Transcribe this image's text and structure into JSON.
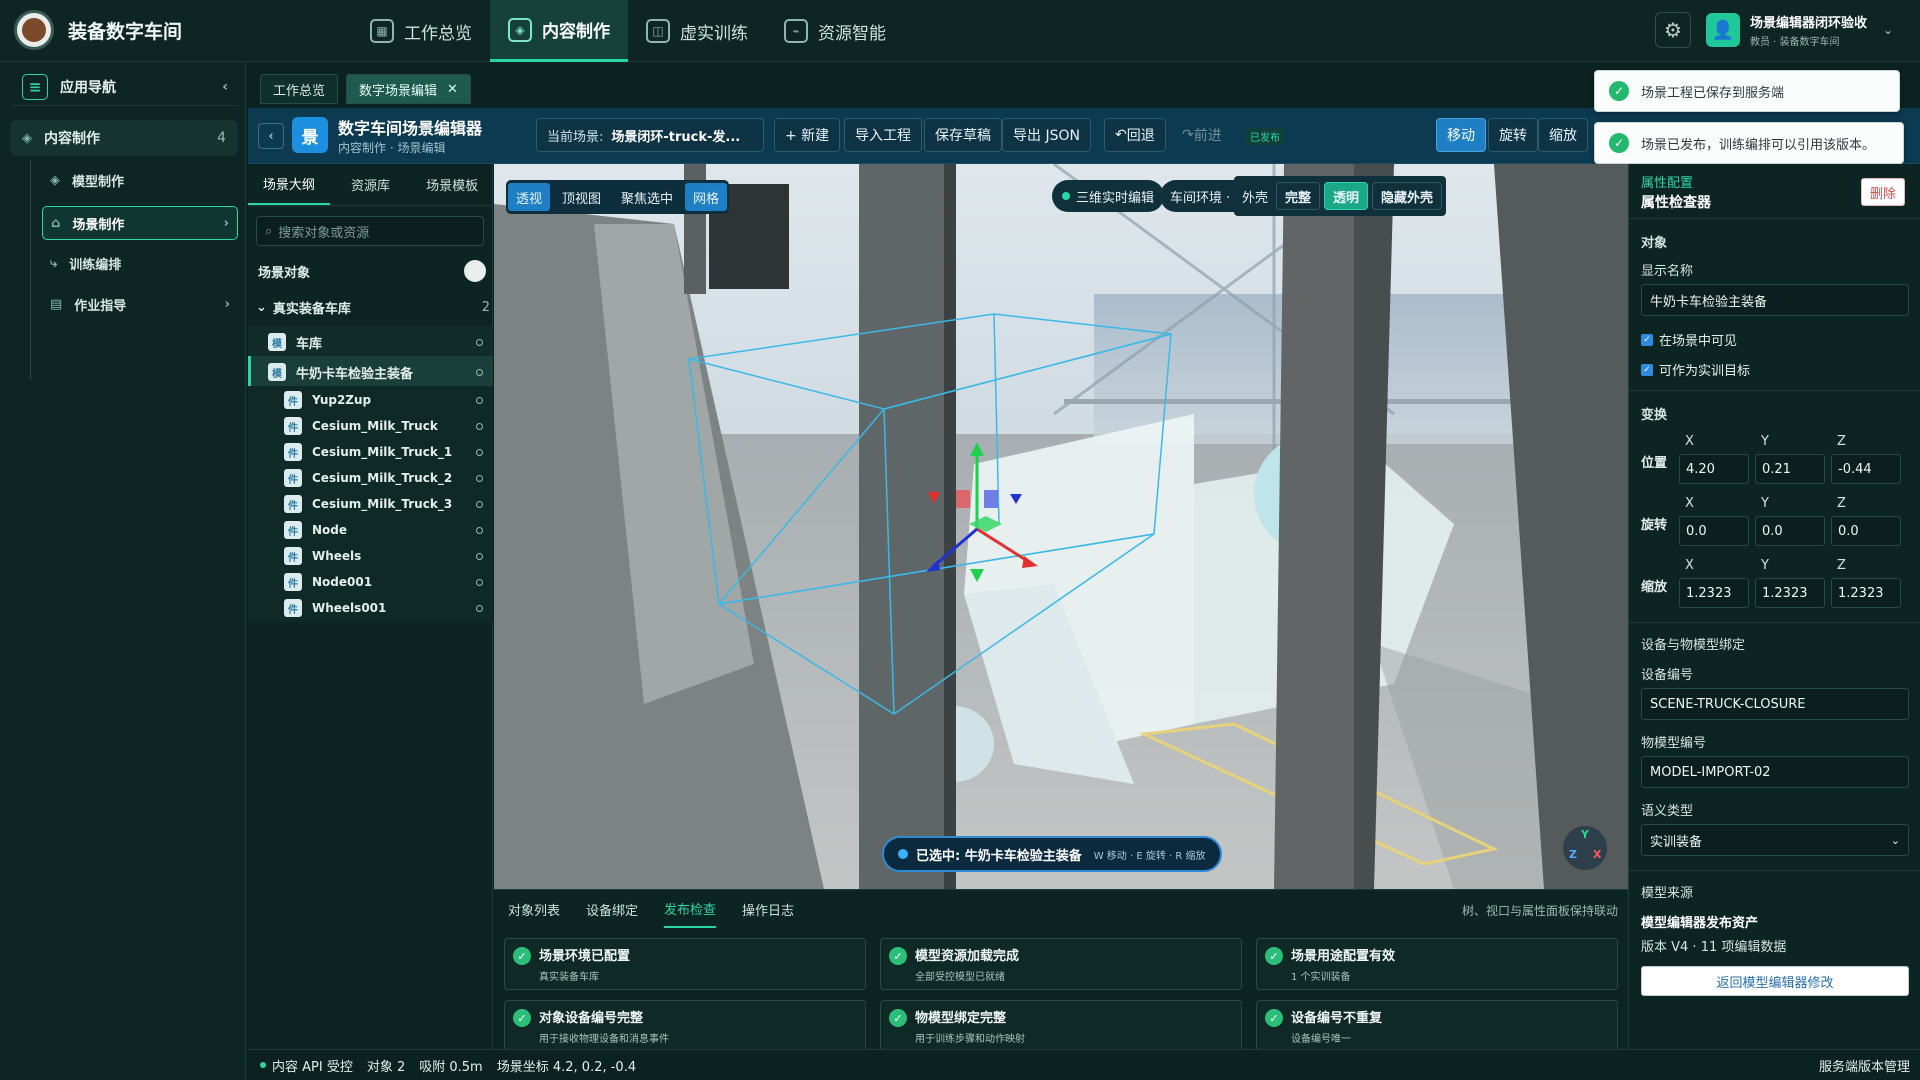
{
  "header": {
    "brand": "装备数字车间",
    "nav": [
      {
        "label": "工作总览",
        "icon": "grid-icon"
      },
      {
        "label": "内容制作",
        "icon": "cube-icon"
      },
      {
        "label": "虚实训练",
        "icon": "panel-icon"
      },
      {
        "label": "资源智能",
        "icon": "brain-icon"
      }
    ],
    "active_nav": "内容制作",
    "user_name": "场景编辑器闭环验收",
    "user_role": "教员 · 装备数字车间"
  },
  "sidebar": {
    "title": "应用导航",
    "group": {
      "label": "内容制作",
      "count": "4"
    },
    "items": [
      {
        "label": "模型制作"
      },
      {
        "label": "场景制作"
      },
      {
        "label": "训练编排"
      },
      {
        "label": "作业指导"
      }
    ]
  },
  "doc_tabs": [
    {
      "label": "工作总览"
    },
    {
      "label": "数字场景编辑"
    }
  ],
  "toolbar": {
    "app_icon": "景",
    "title": "数字车间场景编辑器",
    "subtitle": "内容制作 · 场景编辑",
    "scene_label": "当前场景:",
    "scene_value": "场景闭环-truck-发...",
    "new": "+ 新建",
    "import": "导入工程",
    "save_draft": "保存草稿",
    "export_json": "导出 JSON",
    "undo": "回退",
    "redo": "前进",
    "published": "已发布",
    "move": "移动",
    "rotate": "旋转",
    "scale": "缩放"
  },
  "toasts": [
    "场景工程已保存到服务端",
    "场景已发布，训练编排可以引用该版本。"
  ],
  "outline": {
    "tabs": [
      "场景大纲",
      "资源库",
      "场景模板"
    ],
    "search_placeholder": "搜索对象或资源",
    "section": "场景对象",
    "group": {
      "label": "真实装备车库",
      "count": "2"
    },
    "nodes": [
      {
        "label": "车库",
        "badge": "模",
        "level": 1
      },
      {
        "label": "牛奶卡车检验主装备",
        "badge": "模",
        "level": 1,
        "selected": true
      },
      {
        "label": "Yup2Zup",
        "badge": "件",
        "level": 2
      },
      {
        "label": "Cesium_Milk_Truck",
        "badge": "件",
        "level": 2
      },
      {
        "label": "Cesium_Milk_Truck_1",
        "badge": "件",
        "level": 2
      },
      {
        "label": "Cesium_Milk_Truck_2",
        "badge": "件",
        "level": 2
      },
      {
        "label": "Cesium_Milk_Truck_3",
        "badge": "件",
        "level": 2
      },
      {
        "label": "Node",
        "badge": "件",
        "level": 2
      },
      {
        "label": "Wheels",
        "badge": "件",
        "level": 2
      },
      {
        "label": "Node001",
        "badge": "件",
        "level": 2
      },
      {
        "label": "Wheels001",
        "badge": "件",
        "level": 2
      }
    ]
  },
  "viewport": {
    "tools": [
      "透视",
      "顶视图",
      "聚焦选中",
      "网格"
    ],
    "chip_3d": "三维实时编辑",
    "chip_env": "车间环境 · 正",
    "shell_label": "外壳",
    "shell_full": "完整",
    "shell_trans": "透明",
    "shell_hide": "隐藏外壳",
    "selected_label": "已选中: 牛奶卡车检验主装备",
    "shortcut": "W 移动 · E 旋转 · R 缩放",
    "axis_y": "Y",
    "axis_z": "Z",
    "axis_x": "X"
  },
  "bottom": {
    "tabs": [
      "对象列表",
      "设备绑定",
      "发布检查",
      "操作日志"
    ],
    "note": "树、视口与属性面板保持联动",
    "cards": [
      {
        "title": "场景环境已配置",
        "desc": "真实装备车库"
      },
      {
        "title": "模型资源加载完成",
        "desc": "全部受控模型已就绪"
      },
      {
        "title": "场景用途配置有效",
        "desc": "1 个实训装备"
      },
      {
        "title": "对象设备编号完整",
        "desc": "用于接收物理设备和消息事件"
      },
      {
        "title": "物模型绑定完整",
        "desc": "用于训练步骤和动作映射"
      },
      {
        "title": "设备编号不重复",
        "desc": "设备编号唯一"
      }
    ]
  },
  "statusbar": {
    "api": "内容 API 受控",
    "objects": "对象 2",
    "snap": "吸附 0.5m",
    "coords": "场景坐标 4.2, 0.2, -0.4",
    "right": "服务端版本管理"
  },
  "props": {
    "head": "属性配置",
    "title": "属性检查器",
    "delete": "删除",
    "sec_object": "对象",
    "display_name_label": "显示名称",
    "display_name": "牛奶卡车检验主装备",
    "visible": "在场景中可见",
    "target": "可作为实训目标",
    "sec_transform": "变换",
    "x": "X",
    "y": "Y",
    "z": "Z",
    "pos_label": "位置",
    "pos": [
      "4.20",
      "0.21",
      "-0.44"
    ],
    "rot_label": "旋转",
    "rot": [
      "0.0",
      "0.0",
      "0.0"
    ],
    "scale_label": "缩放",
    "scale": [
      "1.2323",
      "1.2323",
      "1.2323"
    ],
    "sec_binding": "设备与物模型绑定",
    "device_label": "设备编号",
    "device": "SCENE-TRUCK-CLOSURE",
    "model_label": "物模型编号",
    "model": "MODEL-IMPORT-02",
    "semantic_label": "语义类型",
    "semantic": "实训装备",
    "sec_source": "模型来源",
    "source_title": "模型编辑器发布资产",
    "source_version": "版本 V4 · 11 项编辑数据",
    "return_btn": "返回模型编辑器修改"
  }
}
